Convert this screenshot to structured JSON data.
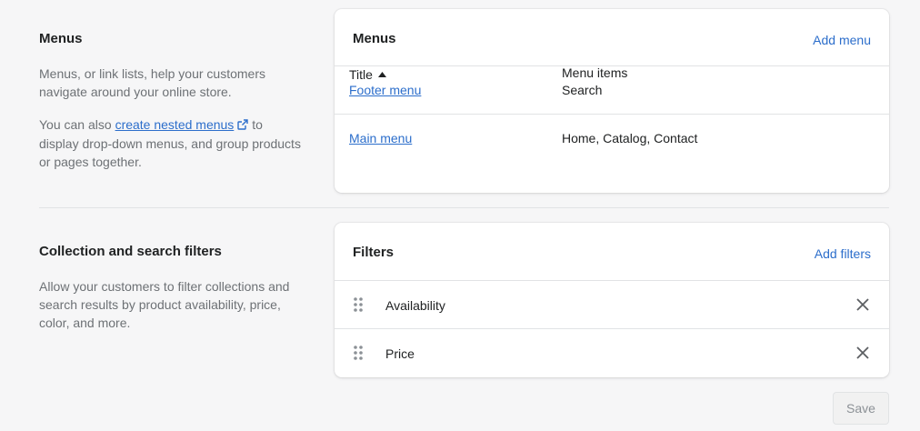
{
  "menus_section": {
    "heading": "Menus",
    "description": "Menus, or link lists, help your customers navigate around your online store.",
    "nested_prefix": "You can also",
    "nested_link": "create nested menus",
    "nested_suffix": "to display drop-down menus, and group products or pages together."
  },
  "menus_card": {
    "title": "Menus",
    "add_label": "Add menu",
    "columns": {
      "title": "Title",
      "items": "Menu items"
    },
    "rows": [
      {
        "name": "Footer menu",
        "items": "Search"
      },
      {
        "name": "Main menu",
        "items": "Home, Catalog, Contact"
      }
    ]
  },
  "filters_section": {
    "heading": "Collection and search filters",
    "description": "Allow your customers to filter collections and search results by product availability, price, color, and more."
  },
  "filters_card": {
    "title": "Filters",
    "add_label": "Add filters",
    "items": [
      {
        "label": "Availability"
      },
      {
        "label": "Price"
      }
    ]
  },
  "footer": {
    "save_label": "Save"
  },
  "colors": {
    "link": "#2c6ecb",
    "muted": "#6d7175",
    "background": "#f6f6f7"
  },
  "icons": [
    "external-link-icon",
    "sort-ascending-icon",
    "drag-handle-icon",
    "close-icon"
  ]
}
